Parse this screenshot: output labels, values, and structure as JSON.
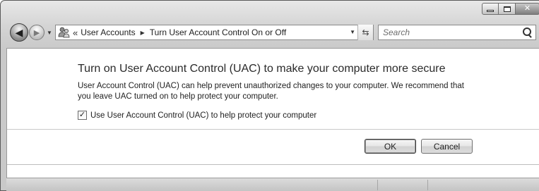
{
  "window": {
    "caption": {
      "minimize_icon": "minimize-icon",
      "maximize_icon": "maximize-icon",
      "close_glyph": "✕"
    }
  },
  "nav": {
    "back_glyph": "◀",
    "forward_glyph": "▶",
    "history_glyph": "▼",
    "address": {
      "icon": "user-accounts-icon",
      "chevrons": "«",
      "breadcrumbs": [
        "User Accounts",
        "Turn User Account Control On or Off"
      ],
      "separator": "▶",
      "dropdown_glyph": "▼",
      "refresh_glyph": "⇆"
    },
    "search": {
      "placeholder": "Search"
    }
  },
  "main": {
    "heading": "Turn on User Account Control (UAC) to make your computer more secure",
    "description": "User Account Control (UAC) can help prevent unauthorized changes to your computer.  We recommend that you leave UAC turned on to help protect your computer.",
    "checkbox": {
      "label": "Use User Account Control (UAC) to help protect your computer",
      "checked": true,
      "mark": "✓"
    },
    "buttons": {
      "ok": "OK",
      "cancel": "Cancel"
    }
  }
}
